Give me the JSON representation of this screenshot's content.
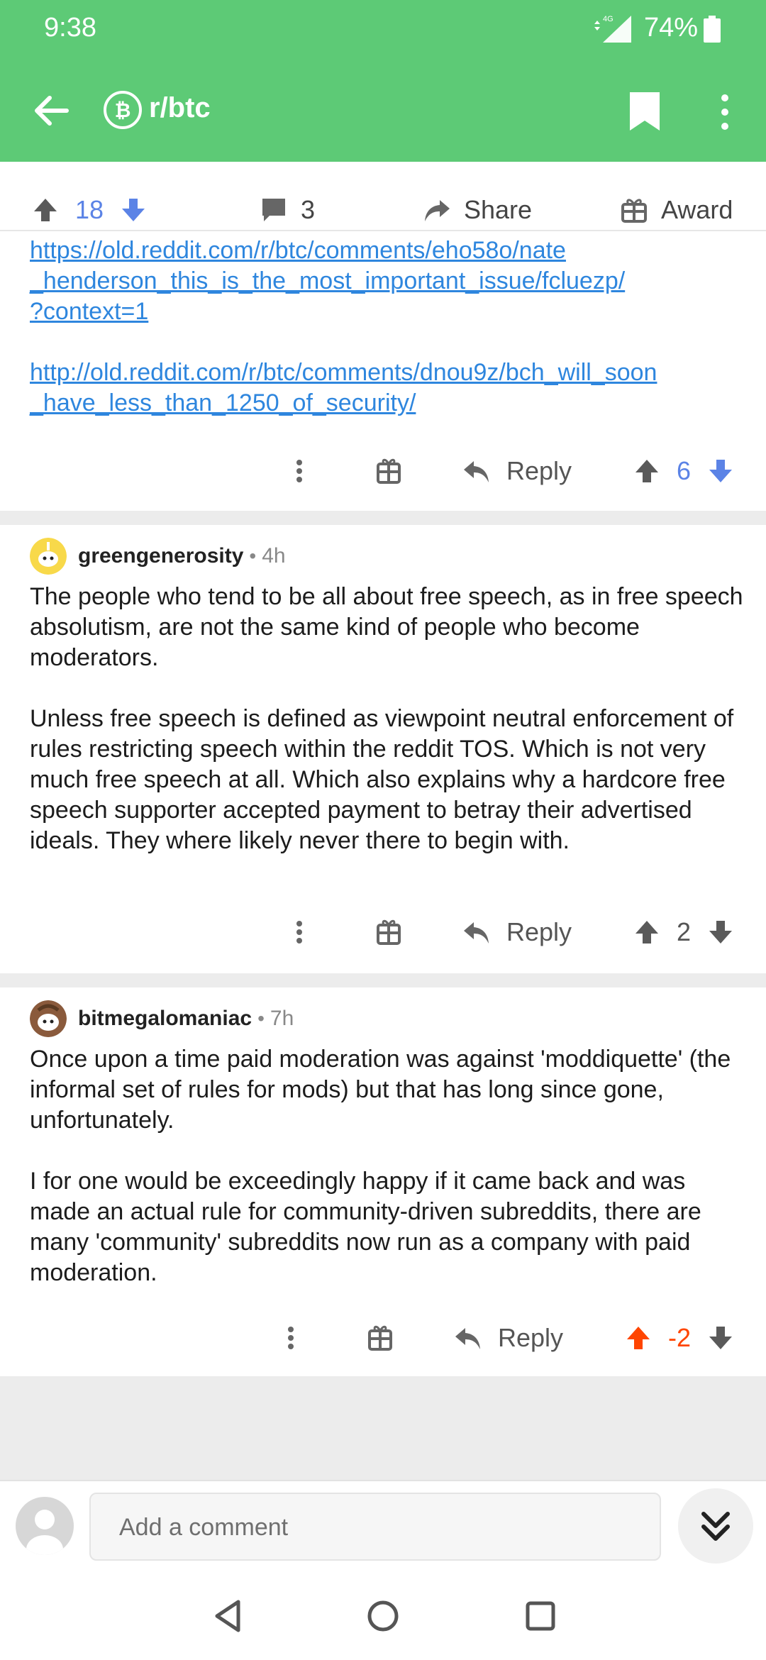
{
  "status_bar": {
    "time": "9:38",
    "network": "4G",
    "battery": "74%"
  },
  "app_bar": {
    "subreddit": "r/btc"
  },
  "post_actions": {
    "upvotes": "18",
    "comments": "3",
    "share": "Share",
    "award": "Award"
  },
  "comments": [
    {
      "links": [
        "https://old.reddit.com/r/btc/comments/eho58o/nate",
        "_henderson_this_is_the_most_important_issue/fcluezp/",
        "?context=1",
        "http://old.reddit.com/r/btc/comments/dnou9z/bch_will_soon",
        "_have_less_than_1250_of_security/"
      ],
      "reply": "Reply",
      "score": "6"
    },
    {
      "author": "greengenerosity",
      "age": "4h",
      "paragraphs": [
        "The people who tend to be all about free speech, as in free speech absolutism, are not the same kind of people who become moderators.",
        "Unless free speech is defined as viewpoint neutral enforcement of rules restricting speech within the reddit TOS. Which is not very much free speech at all. Which also explains why a hardcore free speech supporter accepted payment to betray their advertised ideals. They where likely never there to begin with."
      ],
      "reply": "Reply",
      "score": "2"
    },
    {
      "author": "bitmegalomaniac",
      "age": "7h",
      "paragraphs": [
        "Once upon a time paid moderation was against 'moddiquette' (the informal set of rules for mods) but that has long since gone, unfortunately.",
        "I for one would be exceedingly happy if it came back and was made an actual rule for community-driven subreddits, there are many 'community' subreddits now run as a company with paid moderation."
      ],
      "reply": "Reply",
      "score": "-2"
    }
  ],
  "compose": {
    "placeholder": "Add a comment"
  },
  "colors": {
    "header": "#5dca76",
    "vote_blue": "#5b83e6",
    "upvoted": "#ff4500",
    "link": "#2e86de"
  }
}
